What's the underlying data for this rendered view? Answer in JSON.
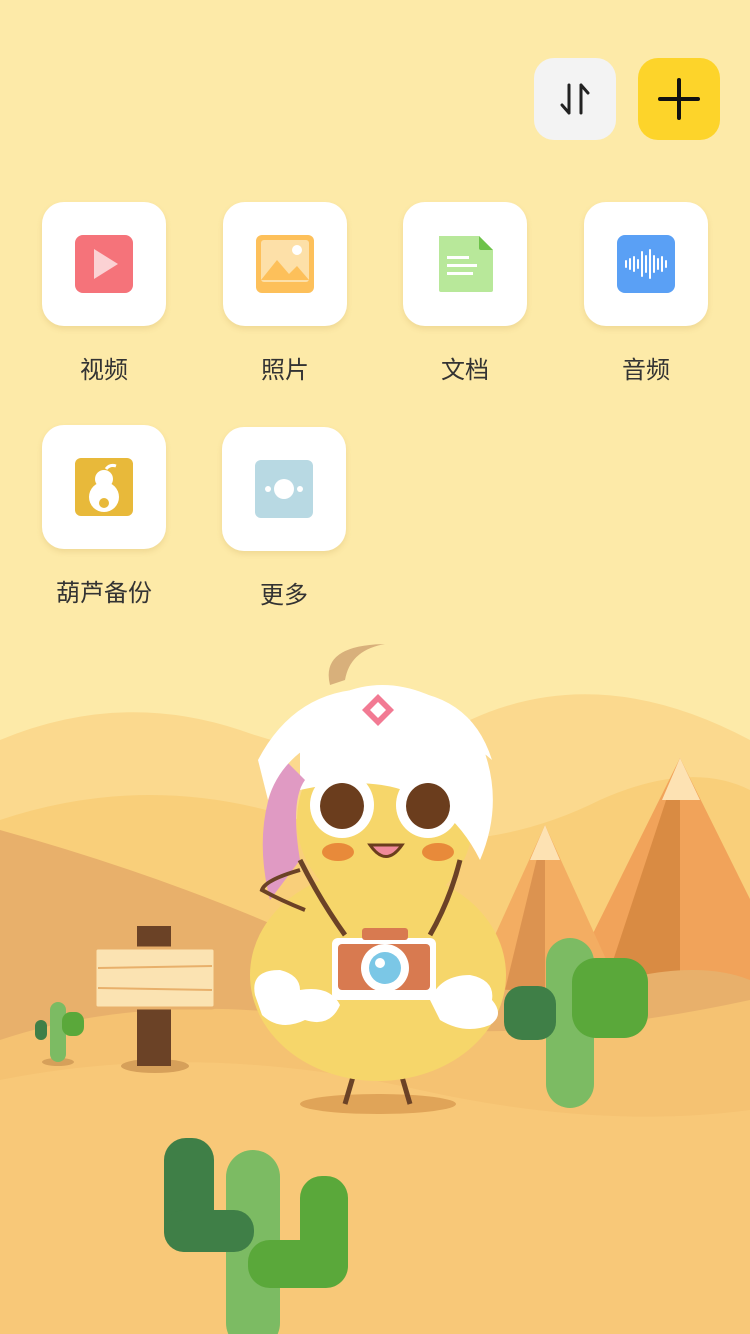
{
  "toolbar": {
    "sort_icon": "sort-arrows-icon",
    "add_icon": "plus-icon",
    "add_color": "#fdd42a"
  },
  "categories": [
    {
      "label": "视频",
      "icon": "video-icon",
      "color": "#f5737a"
    },
    {
      "label": "照片",
      "icon": "photo-icon",
      "color": "#fdc05a"
    },
    {
      "label": "文档",
      "icon": "document-icon",
      "color": "#b8e89a"
    },
    {
      "label": "音频",
      "icon": "audio-icon",
      "color": "#5aa0f5"
    },
    {
      "label": "葫芦备份",
      "icon": "gourd-backup-icon",
      "color": "#e8b93a"
    },
    {
      "label": "更多",
      "icon": "more-icon",
      "color": "#b8d9e3"
    }
  ],
  "colors": {
    "background": "#fdeaa8",
    "sand": "#f6bf67"
  }
}
